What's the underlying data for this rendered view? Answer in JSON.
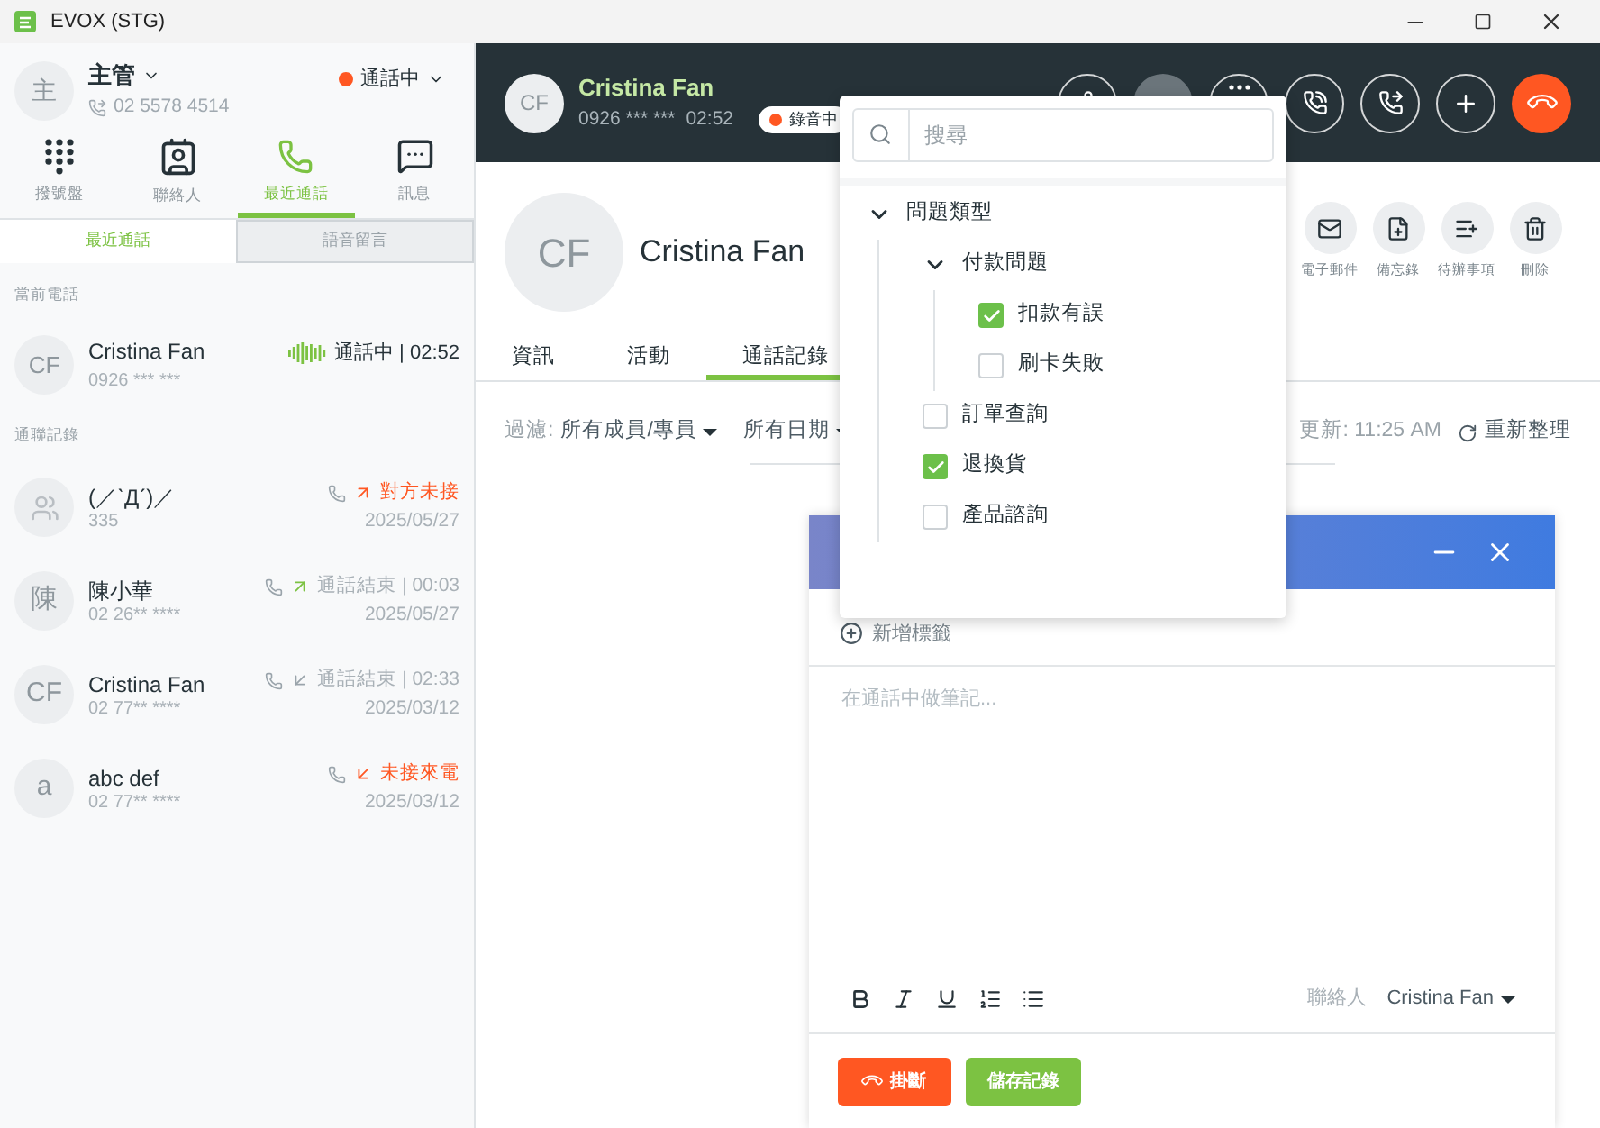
{
  "window": {
    "title": "EVOX (STG)"
  },
  "user": {
    "avatar": "主",
    "name": "主管",
    "phone": "02 5578 4514",
    "status": "通話中"
  },
  "nav": [
    {
      "label": "撥號盤",
      "selected": false
    },
    {
      "label": "聯絡人",
      "selected": false
    },
    {
      "label": "最近通話",
      "selected": true
    },
    {
      "label": "訊息",
      "selected": false
    }
  ],
  "subtabs": [
    {
      "label": "最近通話",
      "selected": true
    },
    {
      "label": "語音留言",
      "selected": false
    }
  ],
  "current_section": "當前電話",
  "current_call": {
    "avatar": "CF",
    "name": "Cristina Fan",
    "number": "0926 *** ***",
    "status": "通話中 | 02:52"
  },
  "history_section": "通聯記錄",
  "history": [
    {
      "name": "(／ˋДˊ)／",
      "number": "335",
      "kind": "outgoing-missed",
      "status": "對方未接",
      "date": "2025/05/27"
    },
    {
      "avatar": "陳",
      "name": "陳小華",
      "number": "02 26** ****",
      "kind": "outgoing",
      "status": "通話結束 | 00:03",
      "date": "2025/05/27"
    },
    {
      "avatar": "CF",
      "name": "Cristina Fan",
      "number": "02 77** ****",
      "kind": "incoming",
      "status": "通話結束 | 02:33",
      "date": "2025/03/12"
    },
    {
      "avatar": "a",
      "name": "abc def",
      "number": "02 77** ****",
      "kind": "incoming-missed",
      "status": "未接來電",
      "date": "2025/03/12"
    }
  ],
  "call_bar": {
    "avatar": "CF",
    "name": "Cristina Fan",
    "number": "0926 *** ***",
    "timer": "02:52",
    "badge": "錄音中"
  },
  "contact": {
    "avatar": "CF",
    "name": "Cristina Fan",
    "actions": [
      {
        "kind": "mail",
        "label": "電子郵件"
      },
      {
        "kind": "memo",
        "label": "備忘錄"
      },
      {
        "kind": "todo",
        "label": "待辦事項"
      },
      {
        "kind": "delete",
        "label": "刪除"
      }
    ]
  },
  "tabs": [
    {
      "label": "資訊",
      "selected": false
    },
    {
      "label": "活動",
      "selected": false
    },
    {
      "label": "通話記錄",
      "selected": true
    }
  ],
  "filter": {
    "label": "過濾:",
    "member": "所有成員/專員",
    "date": "所有日期",
    "updated": "更新: 11:25 AM",
    "refresh": "重新整理"
  },
  "note_panel": {
    "add_tag": "新增標籤",
    "placeholder": "在通話中做筆記...",
    "contact_label": "聯絡人",
    "contact": "Cristina Fan",
    "hangup": "掛斷",
    "save": "儲存記錄"
  },
  "tag_dropdown": {
    "placeholder": "搜尋",
    "tree": [
      {
        "label": "問題類型",
        "expanded": true,
        "children": [
          {
            "label": "付款問題",
            "expanded": true,
            "children": [
              {
                "label": "扣款有誤",
                "checked": true
              },
              {
                "label": "刷卡失敗",
                "checked": false
              }
            ]
          },
          {
            "label": "訂單查詢",
            "checked": false
          },
          {
            "label": "退換貨",
            "checked": true
          },
          {
            "label": "產品諮詢",
            "checked": false
          }
        ]
      }
    ]
  }
}
